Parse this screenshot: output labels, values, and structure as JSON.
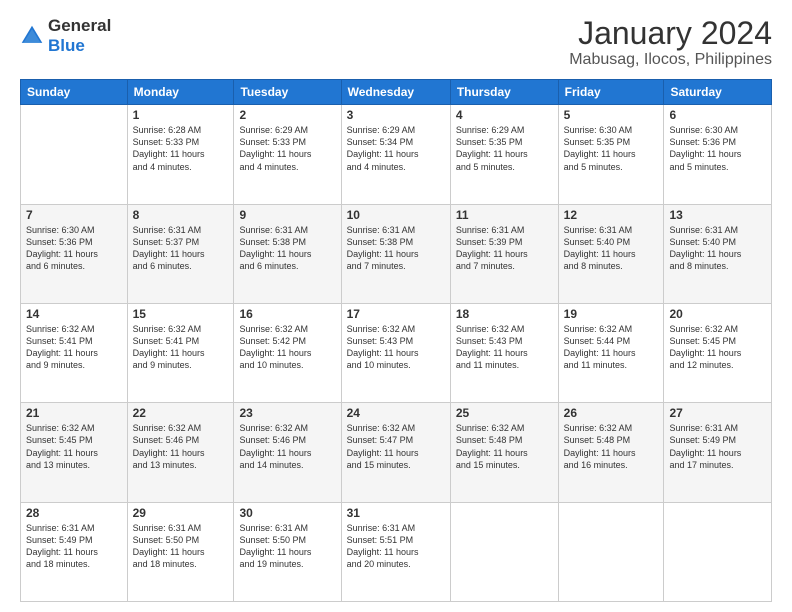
{
  "logo": {
    "general": "General",
    "blue": "Blue"
  },
  "title": "January 2024",
  "subtitle": "Mabusag, Ilocos, Philippines",
  "days_header": [
    "Sunday",
    "Monday",
    "Tuesday",
    "Wednesday",
    "Thursday",
    "Friday",
    "Saturday"
  ],
  "weeks": [
    [
      {
        "day": "",
        "detail": ""
      },
      {
        "day": "1",
        "detail": "Sunrise: 6:28 AM\nSunset: 5:33 PM\nDaylight: 11 hours\nand 4 minutes."
      },
      {
        "day": "2",
        "detail": "Sunrise: 6:29 AM\nSunset: 5:33 PM\nDaylight: 11 hours\nand 4 minutes."
      },
      {
        "day": "3",
        "detail": "Sunrise: 6:29 AM\nSunset: 5:34 PM\nDaylight: 11 hours\nand 4 minutes."
      },
      {
        "day": "4",
        "detail": "Sunrise: 6:29 AM\nSunset: 5:35 PM\nDaylight: 11 hours\nand 5 minutes."
      },
      {
        "day": "5",
        "detail": "Sunrise: 6:30 AM\nSunset: 5:35 PM\nDaylight: 11 hours\nand 5 minutes."
      },
      {
        "day": "6",
        "detail": "Sunrise: 6:30 AM\nSunset: 5:36 PM\nDaylight: 11 hours\nand 5 minutes."
      }
    ],
    [
      {
        "day": "7",
        "detail": "Sunrise: 6:30 AM\nSunset: 5:36 PM\nDaylight: 11 hours\nand 6 minutes."
      },
      {
        "day": "8",
        "detail": "Sunrise: 6:31 AM\nSunset: 5:37 PM\nDaylight: 11 hours\nand 6 minutes."
      },
      {
        "day": "9",
        "detail": "Sunrise: 6:31 AM\nSunset: 5:38 PM\nDaylight: 11 hours\nand 6 minutes."
      },
      {
        "day": "10",
        "detail": "Sunrise: 6:31 AM\nSunset: 5:38 PM\nDaylight: 11 hours\nand 7 minutes."
      },
      {
        "day": "11",
        "detail": "Sunrise: 6:31 AM\nSunset: 5:39 PM\nDaylight: 11 hours\nand 7 minutes."
      },
      {
        "day": "12",
        "detail": "Sunrise: 6:31 AM\nSunset: 5:40 PM\nDaylight: 11 hours\nand 8 minutes."
      },
      {
        "day": "13",
        "detail": "Sunrise: 6:31 AM\nSunset: 5:40 PM\nDaylight: 11 hours\nand 8 minutes."
      }
    ],
    [
      {
        "day": "14",
        "detail": "Sunrise: 6:32 AM\nSunset: 5:41 PM\nDaylight: 11 hours\nand 9 minutes."
      },
      {
        "day": "15",
        "detail": "Sunrise: 6:32 AM\nSunset: 5:41 PM\nDaylight: 11 hours\nand 9 minutes."
      },
      {
        "day": "16",
        "detail": "Sunrise: 6:32 AM\nSunset: 5:42 PM\nDaylight: 11 hours\nand 10 minutes."
      },
      {
        "day": "17",
        "detail": "Sunrise: 6:32 AM\nSunset: 5:43 PM\nDaylight: 11 hours\nand 10 minutes."
      },
      {
        "day": "18",
        "detail": "Sunrise: 6:32 AM\nSunset: 5:43 PM\nDaylight: 11 hours\nand 11 minutes."
      },
      {
        "day": "19",
        "detail": "Sunrise: 6:32 AM\nSunset: 5:44 PM\nDaylight: 11 hours\nand 11 minutes."
      },
      {
        "day": "20",
        "detail": "Sunrise: 6:32 AM\nSunset: 5:45 PM\nDaylight: 11 hours\nand 12 minutes."
      }
    ],
    [
      {
        "day": "21",
        "detail": "Sunrise: 6:32 AM\nSunset: 5:45 PM\nDaylight: 11 hours\nand 13 minutes."
      },
      {
        "day": "22",
        "detail": "Sunrise: 6:32 AM\nSunset: 5:46 PM\nDaylight: 11 hours\nand 13 minutes."
      },
      {
        "day": "23",
        "detail": "Sunrise: 6:32 AM\nSunset: 5:46 PM\nDaylight: 11 hours\nand 14 minutes."
      },
      {
        "day": "24",
        "detail": "Sunrise: 6:32 AM\nSunset: 5:47 PM\nDaylight: 11 hours\nand 15 minutes."
      },
      {
        "day": "25",
        "detail": "Sunrise: 6:32 AM\nSunset: 5:48 PM\nDaylight: 11 hours\nand 15 minutes."
      },
      {
        "day": "26",
        "detail": "Sunrise: 6:32 AM\nSunset: 5:48 PM\nDaylight: 11 hours\nand 16 minutes."
      },
      {
        "day": "27",
        "detail": "Sunrise: 6:31 AM\nSunset: 5:49 PM\nDaylight: 11 hours\nand 17 minutes."
      }
    ],
    [
      {
        "day": "28",
        "detail": "Sunrise: 6:31 AM\nSunset: 5:49 PM\nDaylight: 11 hours\nand 18 minutes."
      },
      {
        "day": "29",
        "detail": "Sunrise: 6:31 AM\nSunset: 5:50 PM\nDaylight: 11 hours\nand 18 minutes."
      },
      {
        "day": "30",
        "detail": "Sunrise: 6:31 AM\nSunset: 5:50 PM\nDaylight: 11 hours\nand 19 minutes."
      },
      {
        "day": "31",
        "detail": "Sunrise: 6:31 AM\nSunset: 5:51 PM\nDaylight: 11 hours\nand 20 minutes."
      },
      {
        "day": "",
        "detail": ""
      },
      {
        "day": "",
        "detail": ""
      },
      {
        "day": "",
        "detail": ""
      }
    ]
  ]
}
